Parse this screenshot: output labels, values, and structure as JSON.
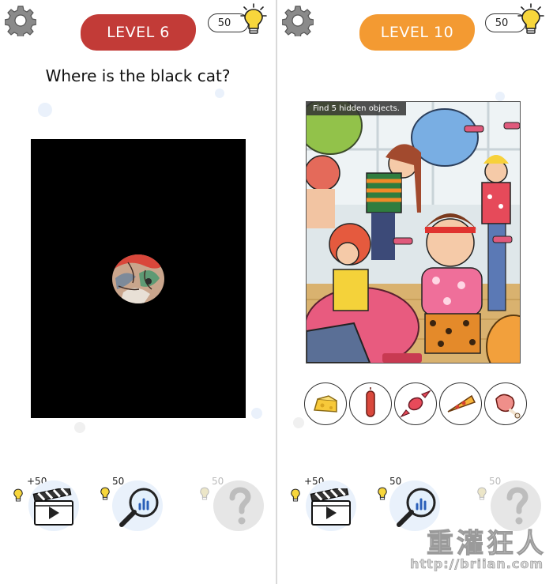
{
  "colors": {
    "level6_pill": "#c23b37",
    "level10_pill": "#f39a32",
    "bulb": "#f7d63c",
    "hint_bg": "#e9f1fb"
  },
  "left": {
    "level": "LEVEL 6",
    "coins": "50",
    "question": "Where is the black cat?",
    "hints": {
      "video_cost": "+50",
      "magnifier_cost": "50",
      "question_cost": "50"
    }
  },
  "right": {
    "level": "LEVEL 10",
    "coins": "50",
    "scene_label": "Find 5 hidden objects.",
    "items": [
      "cheese-icon",
      "sausage-icon",
      "candy-icon",
      "pizza-slice-icon",
      "ham-icon"
    ],
    "hints": {
      "video_cost": "+50",
      "magnifier_cost": "50",
      "question_cost": "50"
    }
  },
  "watermark": {
    "big": "重灌狂人",
    "url": "http://briian.com"
  }
}
